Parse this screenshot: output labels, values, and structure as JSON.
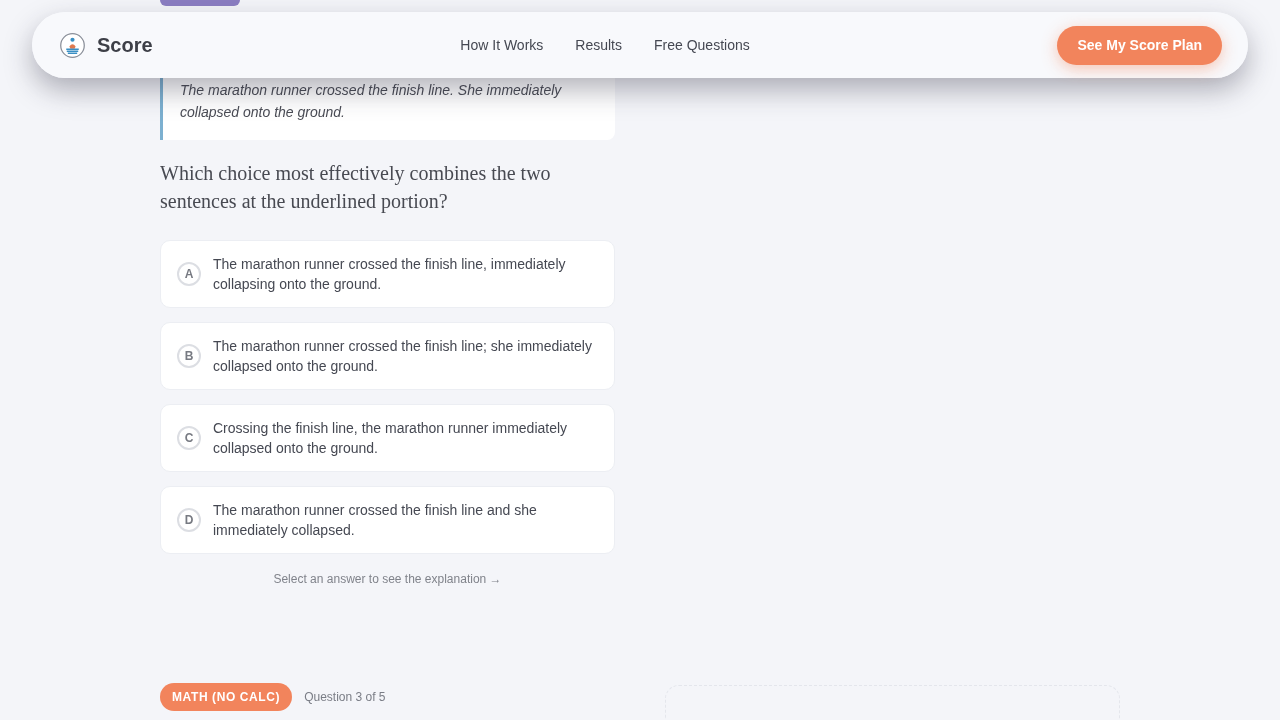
{
  "nav": {
    "brand": "Score",
    "links": [
      "How It Works",
      "Results",
      "Free Questions"
    ],
    "cta": "See My Score Plan"
  },
  "passage": {
    "quote": "The marathon runner crossed the finish line. She immediately collapsed onto the ground."
  },
  "question": {
    "prompt": "Which choice most effectively combines the two sentences at the underlined portion?",
    "options": [
      {
        "letter": "A",
        "text": "The marathon runner crossed the finish line, immediately collapsing onto the ground.",
        "selected": false
      },
      {
        "letter": "B",
        "text": "The marathon runner crossed the finish line; she immediately collapsed onto the ground.",
        "selected": false
      },
      {
        "letter": "C",
        "text": "Crossing the finish line, the marathon runner immediately collapsed onto the ground.",
        "selected": false
      },
      {
        "letter": "D",
        "text": "The marathon runner crossed the finish line and she immediately collapsed.",
        "selected": false
      }
    ],
    "hint": "Select an answer to see the explanation →"
  },
  "next_question": {
    "badge": "MATH (NO CALC)",
    "counter": "Question 3 of 5"
  }
}
